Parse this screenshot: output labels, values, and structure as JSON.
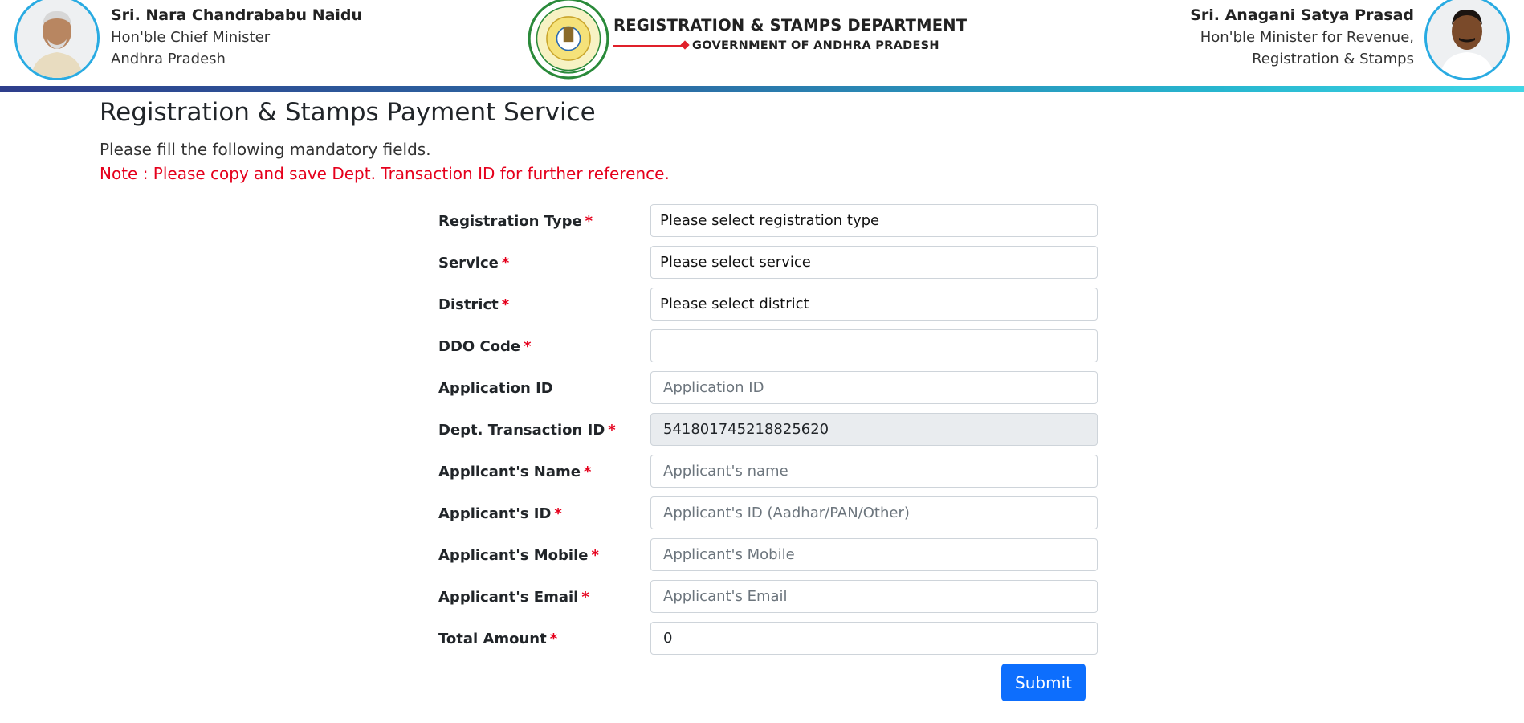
{
  "header": {
    "left_person": {
      "name": "Sri. Nara Chandrababu Naidu",
      "title_line1": "Hon'ble Chief Minister",
      "title_line2": "Andhra Pradesh"
    },
    "right_person": {
      "name": "Sri. Anagani Satya Prasad",
      "title_line1": "Hon'ble Minister for Revenue,",
      "title_line2": "Registration & Stamps"
    },
    "department": "REGISTRATION & STAMPS DEPARTMENT",
    "government": "GOVERNMENT OF ANDHRA PRADESH",
    "emblem_icon": "state-emblem-icon"
  },
  "page": {
    "title": "Registration & Stamps Payment Service",
    "instruction": "Please fill the following mandatory fields.",
    "note": "Note : Please copy and save Dept. Transaction ID for further reference."
  },
  "form": {
    "fields": [
      {
        "label": "Registration Type",
        "required": "*",
        "value": "Please select registration type",
        "placeholder": ""
      },
      {
        "label": "Service",
        "required": "*",
        "value": "Please select service",
        "placeholder": ""
      },
      {
        "label": "District",
        "required": "*",
        "value": "Please select district",
        "placeholder": ""
      },
      {
        "label": "DDO Code",
        "required": "*",
        "value": "",
        "placeholder": ""
      },
      {
        "label": "Application ID",
        "required": "",
        "value": "",
        "placeholder": "Application ID"
      },
      {
        "label": "Dept. Transaction ID",
        "required": "*",
        "value": "541801745218825620",
        "placeholder": ""
      },
      {
        "label": "Applicant's Name",
        "required": "*",
        "value": "",
        "placeholder": "Applicant's name"
      },
      {
        "label": "Applicant's ID",
        "required": "*",
        "value": "",
        "placeholder": "Applicant's ID (Aadhar/PAN/Other)"
      },
      {
        "label": "Applicant's Mobile",
        "required": "*",
        "value": "",
        "placeholder": "Applicant's Mobile"
      },
      {
        "label": "Applicant's Email",
        "required": "*",
        "value": "",
        "placeholder": "Applicant's Email"
      },
      {
        "label": "Total Amount",
        "required": "*",
        "value": "0",
        "placeholder": ""
      }
    ],
    "submit_label": "Submit"
  },
  "colors": {
    "accent": "#0d6efd",
    "required": "#e5001c",
    "avatar_ring": "#29abe2"
  }
}
